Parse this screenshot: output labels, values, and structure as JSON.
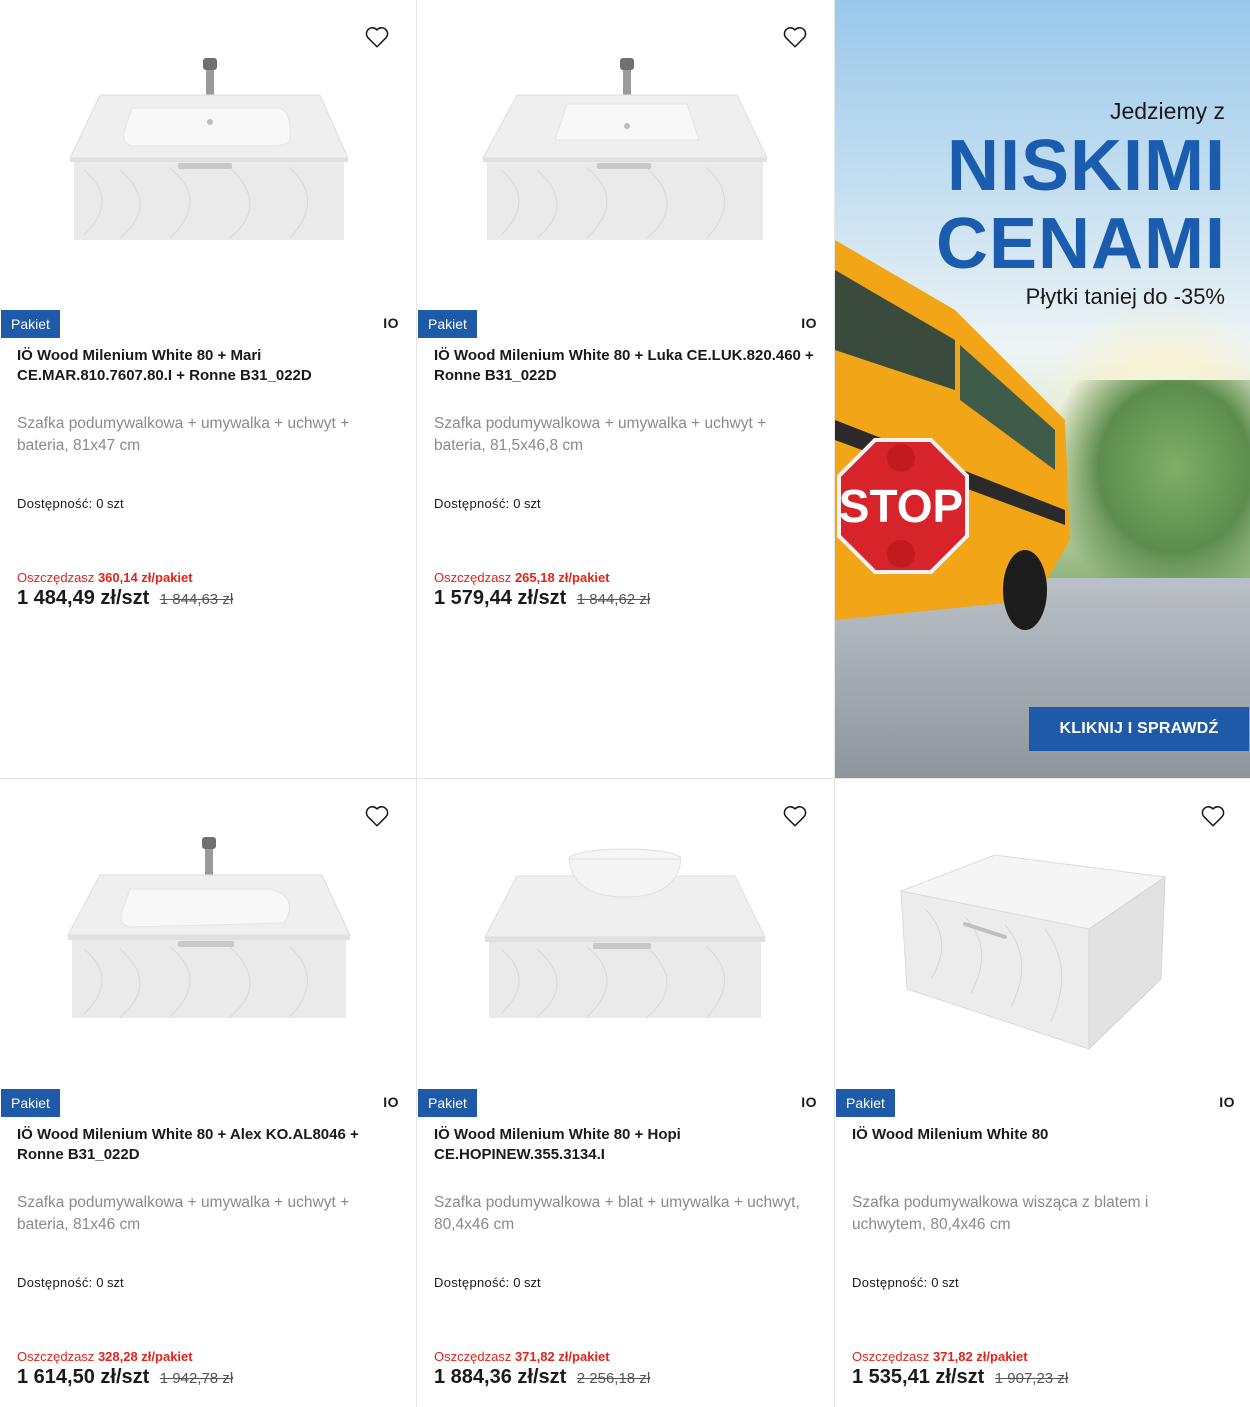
{
  "products": [
    {
      "badge": "Pakiet",
      "brand": "IO",
      "title": "IÖ Wood Milenium White 80 + Mari CE.MAR.810.7607.80.I + Ronne B31_022D",
      "description": "Szafka podumywalkowa + umywalka + uchwyt + bateria, 81x47 cm",
      "availability_label": "Dostępność:",
      "availability_value": "0 szt",
      "save_label": "Oszczędzasz",
      "save_amount": "360,14 zł/pakiet",
      "price": "1 484,49 zł/szt",
      "old_price": "1 844,63 zł",
      "image": "washbasin-cabinet-with-faucet"
    },
    {
      "badge": "Pakiet",
      "brand": "IO",
      "title": "IÖ Wood Milenium White 80 + Luka CE.LUK.820.460 + Ronne B31_022D",
      "description": "Szafka podumywalkowa + umywalka + uchwyt + bateria, 81,5x46,8 cm",
      "availability_label": "Dostępność:",
      "availability_value": "0 szt",
      "save_label": "Oszczędzasz",
      "save_amount": "265,18 zł/pakiet",
      "price": "1 579,44 zł/szt",
      "old_price": "1 844,62 zł",
      "image": "washbasin-cabinet-square-sink"
    },
    {
      "badge": "Pakiet",
      "brand": "IO",
      "title": "IÖ Wood Milenium White 80 + Alex KO.AL8046 + Ronne B31_022D",
      "description": "Szafka podumywalkowa + umywalka + uchwyt + bateria, 81x46 cm",
      "availability_label": "Dostępność:",
      "availability_value": "0 szt",
      "save_label": "Oszczędzasz",
      "save_amount": "328,28 zł/pakiet",
      "price": "1 614,50 zł/szt",
      "old_price": "1 942,78 zł",
      "image": "washbasin-cabinet-with-faucet"
    },
    {
      "badge": "Pakiet",
      "brand": "IO",
      "title": "IÖ Wood Milenium White 80 + Hopi CE.HOPINEW.355.3134.I",
      "description": "Szafka podumywalkowa + blat + umywalka + uchwyt, 80,4x46 cm",
      "availability_label": "Dostępność:",
      "availability_value": "0 szt",
      "save_label": "Oszczędzasz",
      "save_amount": "371,82 zł/pakiet",
      "price": "1 884,36 zł/szt",
      "old_price": "2 256,18 zł",
      "image": "cabinet-with-bowl-sink"
    },
    {
      "badge": "Pakiet",
      "brand": "IO",
      "title": "IÖ Wood Milenium White 80",
      "description": "Szafka podumywalkowa wisząca z blatem i uchwytem, 80,4x46 cm",
      "availability_label": "Dostępność:",
      "availability_value": "0 szt",
      "save_label": "Oszczędzasz",
      "save_amount": "371,82 zł/pakiet",
      "price": "1 535,41 zł/szt",
      "old_price": "1 907,23 zł",
      "image": "wall-cabinet-with-top"
    }
  ],
  "banner": {
    "line1": "Jedziemy z",
    "line2": "NISKIMI",
    "line3": "CENAMI",
    "line4": "Płytki taniej do -35%",
    "stop_sign": "STOP",
    "cta": "KLIKNIJ I SPRAWDŹ",
    "accent": "#1b5cae"
  },
  "colors": {
    "badge": "#1e5aa8",
    "save": "#e2231a",
    "description": "#8a8a8a"
  }
}
